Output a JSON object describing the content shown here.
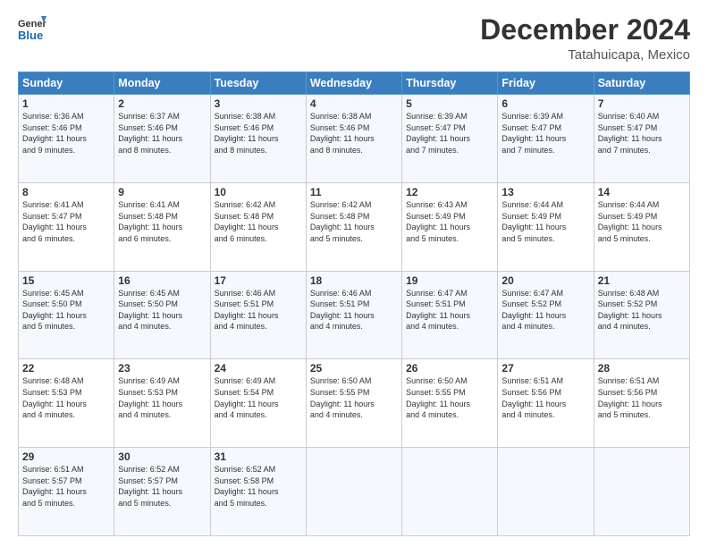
{
  "header": {
    "logo_line1": "General",
    "logo_line2": "Blue",
    "month": "December 2024",
    "location": "Tatahuicapa, Mexico"
  },
  "days_of_week": [
    "Sunday",
    "Monday",
    "Tuesday",
    "Wednesday",
    "Thursday",
    "Friday",
    "Saturday"
  ],
  "weeks": [
    [
      {
        "day": "1",
        "sunrise": "6:36 AM",
        "sunset": "5:46 PM",
        "daylight": "11 hours and 9 minutes."
      },
      {
        "day": "2",
        "sunrise": "6:37 AM",
        "sunset": "5:46 PM",
        "daylight": "11 hours and 8 minutes."
      },
      {
        "day": "3",
        "sunrise": "6:38 AM",
        "sunset": "5:46 PM",
        "daylight": "11 hours and 8 minutes."
      },
      {
        "day": "4",
        "sunrise": "6:38 AM",
        "sunset": "5:46 PM",
        "daylight": "11 hours and 8 minutes."
      },
      {
        "day": "5",
        "sunrise": "6:39 AM",
        "sunset": "5:47 PM",
        "daylight": "11 hours and 7 minutes."
      },
      {
        "day": "6",
        "sunrise": "6:39 AM",
        "sunset": "5:47 PM",
        "daylight": "11 hours and 7 minutes."
      },
      {
        "day": "7",
        "sunrise": "6:40 AM",
        "sunset": "5:47 PM",
        "daylight": "11 hours and 7 minutes."
      }
    ],
    [
      {
        "day": "8",
        "sunrise": "6:41 AM",
        "sunset": "5:47 PM",
        "daylight": "11 hours and 6 minutes."
      },
      {
        "day": "9",
        "sunrise": "6:41 AM",
        "sunset": "5:48 PM",
        "daylight": "11 hours and 6 minutes."
      },
      {
        "day": "10",
        "sunrise": "6:42 AM",
        "sunset": "5:48 PM",
        "daylight": "11 hours and 6 minutes."
      },
      {
        "day": "11",
        "sunrise": "6:42 AM",
        "sunset": "5:48 PM",
        "daylight": "11 hours and 5 minutes."
      },
      {
        "day": "12",
        "sunrise": "6:43 AM",
        "sunset": "5:49 PM",
        "daylight": "11 hours and 5 minutes."
      },
      {
        "day": "13",
        "sunrise": "6:44 AM",
        "sunset": "5:49 PM",
        "daylight": "11 hours and 5 minutes."
      },
      {
        "day": "14",
        "sunrise": "6:44 AM",
        "sunset": "5:49 PM",
        "daylight": "11 hours and 5 minutes."
      }
    ],
    [
      {
        "day": "15",
        "sunrise": "6:45 AM",
        "sunset": "5:50 PM",
        "daylight": "11 hours and 5 minutes."
      },
      {
        "day": "16",
        "sunrise": "6:45 AM",
        "sunset": "5:50 PM",
        "daylight": "11 hours and 4 minutes."
      },
      {
        "day": "17",
        "sunrise": "6:46 AM",
        "sunset": "5:51 PM",
        "daylight": "11 hours and 4 minutes."
      },
      {
        "day": "18",
        "sunrise": "6:46 AM",
        "sunset": "5:51 PM",
        "daylight": "11 hours and 4 minutes."
      },
      {
        "day": "19",
        "sunrise": "6:47 AM",
        "sunset": "5:51 PM",
        "daylight": "11 hours and 4 minutes."
      },
      {
        "day": "20",
        "sunrise": "6:47 AM",
        "sunset": "5:52 PM",
        "daylight": "11 hours and 4 minutes."
      },
      {
        "day": "21",
        "sunrise": "6:48 AM",
        "sunset": "5:52 PM",
        "daylight": "11 hours and 4 minutes."
      }
    ],
    [
      {
        "day": "22",
        "sunrise": "6:48 AM",
        "sunset": "5:53 PM",
        "daylight": "11 hours and 4 minutes."
      },
      {
        "day": "23",
        "sunrise": "6:49 AM",
        "sunset": "5:53 PM",
        "daylight": "11 hours and 4 minutes."
      },
      {
        "day": "24",
        "sunrise": "6:49 AM",
        "sunset": "5:54 PM",
        "daylight": "11 hours and 4 minutes."
      },
      {
        "day": "25",
        "sunrise": "6:50 AM",
        "sunset": "5:55 PM",
        "daylight": "11 hours and 4 minutes."
      },
      {
        "day": "26",
        "sunrise": "6:50 AM",
        "sunset": "5:55 PM",
        "daylight": "11 hours and 4 minutes."
      },
      {
        "day": "27",
        "sunrise": "6:51 AM",
        "sunset": "5:56 PM",
        "daylight": "11 hours and 4 minutes."
      },
      {
        "day": "28",
        "sunrise": "6:51 AM",
        "sunset": "5:56 PM",
        "daylight": "11 hours and 5 minutes."
      }
    ],
    [
      {
        "day": "29",
        "sunrise": "6:51 AM",
        "sunset": "5:57 PM",
        "daylight": "11 hours and 5 minutes."
      },
      {
        "day": "30",
        "sunrise": "6:52 AM",
        "sunset": "5:57 PM",
        "daylight": "11 hours and 5 minutes."
      },
      {
        "day": "31",
        "sunrise": "6:52 AM",
        "sunset": "5:58 PM",
        "daylight": "11 hours and 5 minutes."
      },
      null,
      null,
      null,
      null
    ]
  ]
}
